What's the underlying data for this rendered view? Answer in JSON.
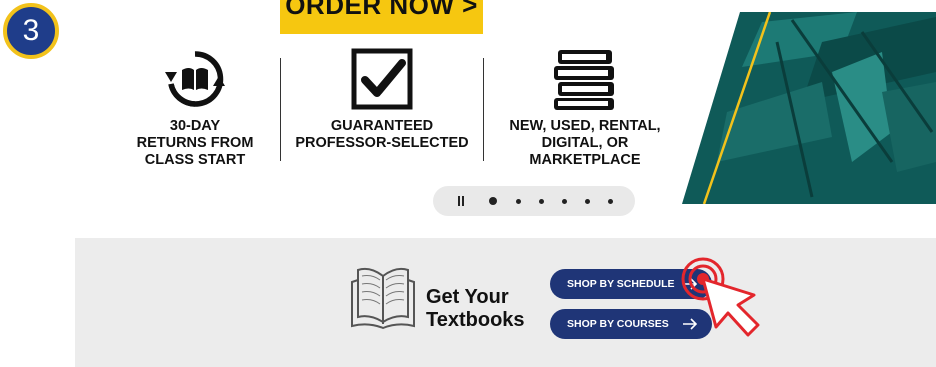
{
  "step": {
    "number": "3"
  },
  "hero": {
    "order_label": "ORDER NOW >",
    "features": [
      {
        "icon": "returns-book-icon",
        "text": "30-DAY\nRETURNS FROM\nCLASS START"
      },
      {
        "icon": "checkbox-icon",
        "text": "GUARANTEED\nPROFESSOR-SELECTED"
      },
      {
        "icon": "book-stack-icon",
        "text": "NEW, USED, RENTAL,\nDIGITAL, OR\nMARKETPLACE"
      }
    ],
    "carousel": {
      "slides": 6,
      "active_index": 0,
      "pause_icon": "pause-icon"
    },
    "image_icon": "books-photo-image"
  },
  "textbooks": {
    "icon": "open-book-icon",
    "title": "Get Your\nTextbooks",
    "buttons": [
      {
        "label": "SHOP BY SCHEDULE",
        "icon": "arrow-right-icon"
      },
      {
        "label": "SHOP BY COURSES",
        "icon": "arrow-right-icon"
      }
    ],
    "cursor_icon": "click-cursor-icon"
  },
  "colors": {
    "badge": "#1f3d8a",
    "badge_ring": "#f2c21b",
    "order_button": "#f6c710",
    "pill": "#1f3577",
    "panel": "#ececec",
    "cursor": "#e3262c",
    "hero_teal": "#0f5a58"
  }
}
